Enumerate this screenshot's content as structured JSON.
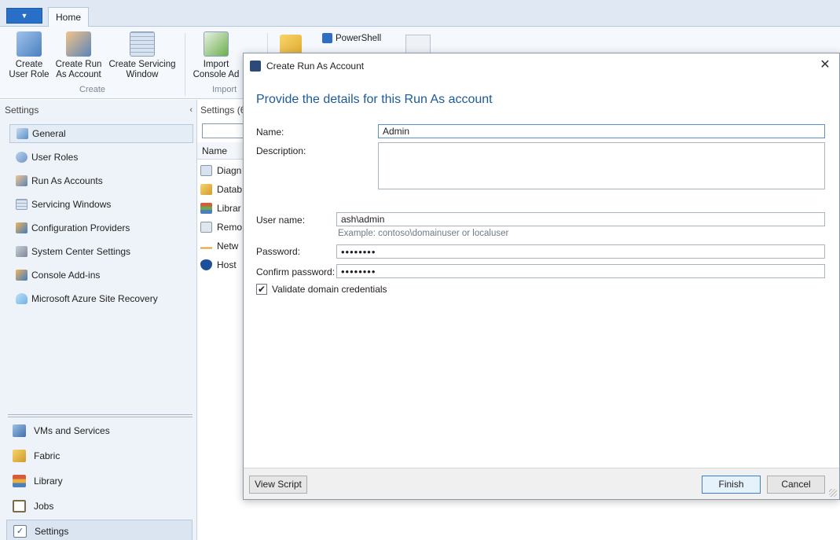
{
  "ribbon": {
    "tab_home": "Home",
    "groups": {
      "create": "Create",
      "import": "Import"
    },
    "buttons": {
      "create_user_role": [
        "Create",
        "User Role"
      ],
      "create_run_as": [
        "Create Run",
        "As Account"
      ],
      "create_servicing": [
        "Create Servicing",
        "Window"
      ],
      "import_console": [
        "Import",
        "Console Ad"
      ],
      "powershell": "PowerShell"
    }
  },
  "leftnav": {
    "header": "Settings",
    "items": [
      {
        "label": "General",
        "icon": "general-icon",
        "selected": true
      },
      {
        "label": "User Roles",
        "icon": "user-roles-icon"
      },
      {
        "label": "Run As Accounts",
        "icon": "run-as-accounts-icon"
      },
      {
        "label": "Servicing Windows",
        "icon": "servicing-windows-icon"
      },
      {
        "label": "Configuration Providers",
        "icon": "configuration-providers-icon"
      },
      {
        "label": "System Center Settings",
        "icon": "system-center-settings-icon"
      },
      {
        "label": "Console Add-ins",
        "icon": "console-addins-icon"
      },
      {
        "label": "Microsoft Azure Site Recovery",
        "icon": "azure-site-recovery-icon"
      }
    ],
    "workspaces": [
      {
        "label": "VMs and Services",
        "icon": "vms-services-icon"
      },
      {
        "label": "Fabric",
        "icon": "fabric-icon"
      },
      {
        "label": "Library",
        "icon": "library-icon"
      },
      {
        "label": "Jobs",
        "icon": "jobs-icon"
      },
      {
        "label": "Settings",
        "icon": "settings-icon",
        "selected": true
      }
    ]
  },
  "middle": {
    "header": "Settings (6",
    "column_name": "Name",
    "rows": [
      {
        "label": "Diagn",
        "icon": "diagnostics-icon"
      },
      {
        "label": "Datab",
        "icon": "database-icon"
      },
      {
        "label": "Librar",
        "icon": "library-settings-icon"
      },
      {
        "label": "Remo",
        "icon": "remote-icon"
      },
      {
        "label": "Netw",
        "icon": "network-icon"
      },
      {
        "label": "Host",
        "icon": "host-icon"
      }
    ]
  },
  "dialog": {
    "title": "Create Run As Account",
    "heading": "Provide the details for this Run As account",
    "name_label": "Name:",
    "name_value": "Admin",
    "description_label": "Description:",
    "description_value": "",
    "username_label": "User name:",
    "username_value": "ash\\admin",
    "username_example": "Example: contoso\\domainuser or localuser",
    "password_label": "Password:",
    "password_value": "••••••••",
    "confirm_label": "Confirm password:",
    "confirm_value": "••••••••",
    "validate_label": "Validate domain credentials",
    "validate_checked": true,
    "view_script": "View Script",
    "finish": "Finish",
    "cancel": "Cancel"
  },
  "colors": {
    "accent": "#1d5a9a",
    "ribbon_bg": "#dfe8f3",
    "nav_bg": "#eef3f9"
  }
}
